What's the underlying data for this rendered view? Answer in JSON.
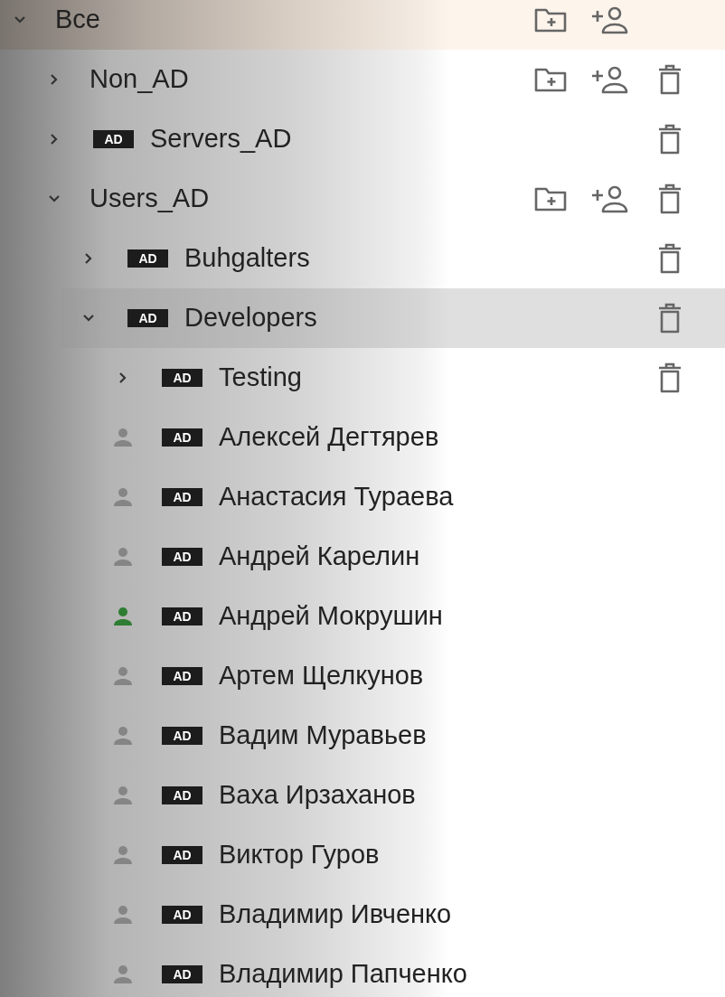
{
  "tree": [
    {
      "kind": "folder",
      "label": "Все",
      "expanded": true,
      "selected": false,
      "add_folder": true,
      "add_user": true,
      "delete": false,
      "children": [
        {
          "kind": "folder",
          "label": "Non_AD",
          "expanded": false,
          "selected": false,
          "add_folder": true,
          "add_user": true,
          "delete": true
        },
        {
          "kind": "folder",
          "label": "Servers_AD",
          "badge": "AD",
          "expanded": false,
          "selected": false,
          "add_folder": false,
          "add_user": false,
          "delete": true
        },
        {
          "kind": "folder",
          "label": "Users_AD",
          "expanded": true,
          "selected": false,
          "add_folder": true,
          "add_user": true,
          "delete": true,
          "children": [
            {
              "kind": "folder",
              "label": "Buhgalters",
              "badge": "AD",
              "expanded": false,
              "selected": false,
              "add_folder": false,
              "add_user": false,
              "delete": true
            },
            {
              "kind": "folder",
              "label": "Developers",
              "badge": "AD",
              "expanded": true,
              "selected": true,
              "add_folder": false,
              "add_user": false,
              "delete": true,
              "children": [
                {
                  "kind": "folder",
                  "label": "Testing",
                  "badge": "AD",
                  "expanded": false,
                  "selected": false,
                  "add_folder": false,
                  "add_user": false,
                  "delete": true
                },
                {
                  "kind": "user",
                  "label": "Алексей Дегтярев",
                  "badge": "AD",
                  "online": false,
                  "selected": false
                },
                {
                  "kind": "user",
                  "label": "Анастасия Тураева",
                  "badge": "AD",
                  "online": false,
                  "selected": false
                },
                {
                  "kind": "user",
                  "label": "Андрей Карелин",
                  "badge": "AD",
                  "online": false,
                  "selected": false
                },
                {
                  "kind": "user",
                  "label": "Андрей Мокрушин",
                  "badge": "AD",
                  "online": true,
                  "selected": false
                },
                {
                  "kind": "user",
                  "label": "Артем Щелкунов",
                  "badge": "AD",
                  "online": false,
                  "selected": false
                },
                {
                  "kind": "user",
                  "label": "Вадим Муравьев",
                  "badge": "AD",
                  "online": false,
                  "selected": false
                },
                {
                  "kind": "user",
                  "label": "Ваха Ирзаханов",
                  "badge": "AD",
                  "online": false,
                  "selected": false
                },
                {
                  "kind": "user",
                  "label": "Виктор Гуров",
                  "badge": "AD",
                  "online": false,
                  "selected": false
                },
                {
                  "kind": "user",
                  "label": "Владимир Ивченко",
                  "badge": "AD",
                  "online": false,
                  "selected": false
                },
                {
                  "kind": "user",
                  "label": "Владимир Папченко",
                  "badge": "AD",
                  "online": false,
                  "selected": false
                }
              ]
            }
          ]
        }
      ]
    }
  ]
}
